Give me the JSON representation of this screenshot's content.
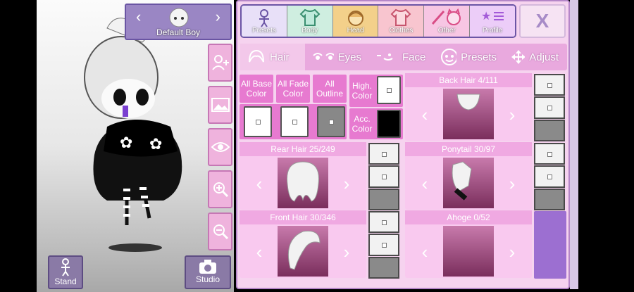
{
  "character": {
    "name": "Default Boy"
  },
  "side_buttons": [
    "add-character-icon",
    "background-icon",
    "eye-icon",
    "zoom-in-icon",
    "zoom-out-icon"
  ],
  "bottom": {
    "stand_label": "Stand",
    "studio_label": "Studio"
  },
  "categories": [
    {
      "label": "Presets",
      "icon": "presets-body-icon",
      "color": "#8f7cc4"
    },
    {
      "label": "Body",
      "icon": "body-shirt-icon",
      "color": "#6bc7a4"
    },
    {
      "label": "Head",
      "icon": "head-icon",
      "color": "#e0a45c"
    },
    {
      "label": "Clothes",
      "icon": "clothes-shirt-icon",
      "color": "#f08aa6"
    },
    {
      "label": "Other",
      "icon": "other-cat-sword-icon",
      "color": "#f48dc2"
    },
    {
      "label": "Profile",
      "icon": "profile-star-icon",
      "color": "#c58ff0"
    }
  ],
  "close_label": "X",
  "subtabs": [
    {
      "label": "Hair",
      "icon": "hair-icon"
    },
    {
      "label": "Eyes",
      "icon": "eyes-icon"
    },
    {
      "label": "Face",
      "icon": "face-icon"
    },
    {
      "label": "Presets",
      "icon": "presets-face-icon"
    },
    {
      "label": "Adjust",
      "icon": "adjust-move-icon"
    }
  ],
  "colors": {
    "all_base": "All Base Color",
    "all_fade": "All Fade Color",
    "all_outline": "All Outline",
    "high": "High. Color",
    "acc": "Acc. Color"
  },
  "selectors": {
    "back_hair": "Back Hair 4/111",
    "rear_hair": "Rear Hair 25/249",
    "ponytail": "Ponytail 30/97",
    "front_hair": "Front Hair 30/346",
    "ahoge": "Ahoge 0/52"
  }
}
